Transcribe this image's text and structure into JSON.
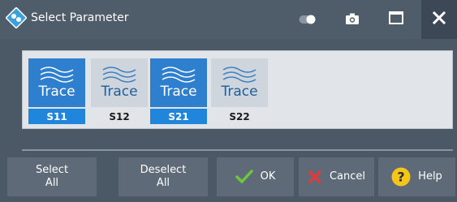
{
  "window": {
    "title": "Select Parameter"
  },
  "traces": [
    {
      "word": "Trace",
      "label": "S11",
      "selected": true
    },
    {
      "word": "Trace",
      "label": "S12",
      "selected": false
    },
    {
      "word": "Trace",
      "label": "S21",
      "selected": true
    },
    {
      "word": "Trace",
      "label": "S22",
      "selected": false
    }
  ],
  "buttons": {
    "select_all_line1": "Select",
    "select_all_line2": "All",
    "deselect_all_line1": "Deselect",
    "deselect_all_line2": "All",
    "ok": "OK",
    "cancel": "Cancel",
    "help": "Help"
  },
  "icons": {
    "app": "rs-diamond-icon",
    "toggle": "toggle-icon",
    "camera": "camera-icon",
    "maximize": "maximize-icon",
    "close": "close-icon",
    "trace": "wave-icon",
    "ok": "checkmark-icon",
    "cancel": "x-icon",
    "help": "question-icon"
  },
  "colors": {
    "selected_tile": "#2f7fcf",
    "selected_label": "#1f86dc",
    "ok_check": "#6cc83a",
    "cancel_x": "#e03a3a",
    "help_badge": "#f5c518"
  }
}
